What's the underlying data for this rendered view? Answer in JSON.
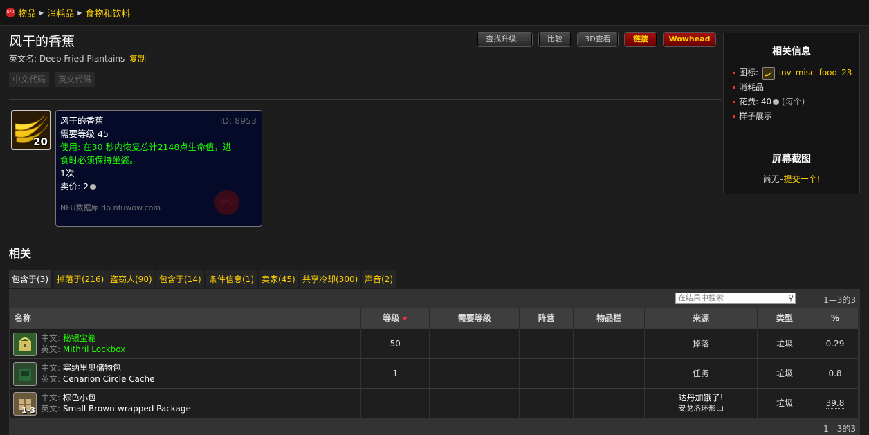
{
  "breadcrumb": {
    "logo_text": "NFU",
    "items": [
      "物品",
      "消耗品",
      "食物和饮料"
    ]
  },
  "item": {
    "title": "风干的香蕉",
    "english_label": "英文名:",
    "english_name": "Deep Fried Plantains",
    "copy_label": "复制",
    "code_buttons": [
      "中文代码",
      "英文代码"
    ],
    "stack": "20"
  },
  "toolbar": {
    "upgrade": "查找升级...",
    "compare": "比较",
    "view3d": "3D查看",
    "link": "链接",
    "wowhead": "Wowhead"
  },
  "tooltip": {
    "name": "风干的香蕉",
    "id": "ID: 8953",
    "level": "需要等级 45",
    "use_line1": "使用: 在30 秒内恢复总计2148点生命值，进",
    "use_line2": "食时必须保持坐姿。",
    "charges": "1次",
    "sell_label": "卖价: 2",
    "footer": "NFU数据库 db.nfuwow.com",
    "watermark": "NFU"
  },
  "sidebar": {
    "info_title": "相关信息",
    "icon_label": "图标:",
    "icon_name": "inv_misc_food_23",
    "category": "消耗品",
    "cost_label": "花费: 40",
    "cost_unit": "(每个)",
    "sample": "样子展示",
    "screens_title": "屏幕截图",
    "screens_none": "尚无–",
    "screens_submit": "提交一个!"
  },
  "related": {
    "title": "相关",
    "tabs": [
      "包含于(3)",
      "掉落于(216)",
      "盗窃人(90)",
      "包含于(14)",
      "条件信息(1)",
      "卖家(45)",
      "共享冷却(300)",
      "声音(2)"
    ],
    "search_placeholder": "在结果中搜索",
    "pagination": "1—3的3",
    "columns": [
      "名称",
      "等级",
      "需要等级",
      "阵营",
      "物品栏",
      "来源",
      "类型",
      "%"
    ],
    "rows": [
      {
        "cn_label": "中文:",
        "cn": "秘银宝箱",
        "en_label": "英文:",
        "en": "Mithril Lockbox",
        "level": "50",
        "req": "",
        "side": "",
        "slot": "",
        "source": "掉落",
        "source2": "",
        "type": "垃圾",
        "pct": "0.29",
        "stack": ""
      },
      {
        "cn_label": "中文:",
        "cn": "塞纳里奥储物包",
        "en_label": "英文:",
        "en": "Cenarion Circle Cache",
        "level": "1",
        "req": "",
        "side": "",
        "slot": "",
        "source": "任务",
        "source2": "",
        "type": "垃圾",
        "pct": "0.8",
        "stack": ""
      },
      {
        "cn_label": "中文:",
        "cn": "棕色小包",
        "en_label": "英文:",
        "en": "Small Brown-wrapped Package",
        "level": "",
        "req": "",
        "side": "",
        "slot": "",
        "source": "达丹加饿了!",
        "source2": "安戈洛环形山",
        "type": "垃圾",
        "pct": "39.8",
        "stack": "1-3"
      }
    ]
  }
}
